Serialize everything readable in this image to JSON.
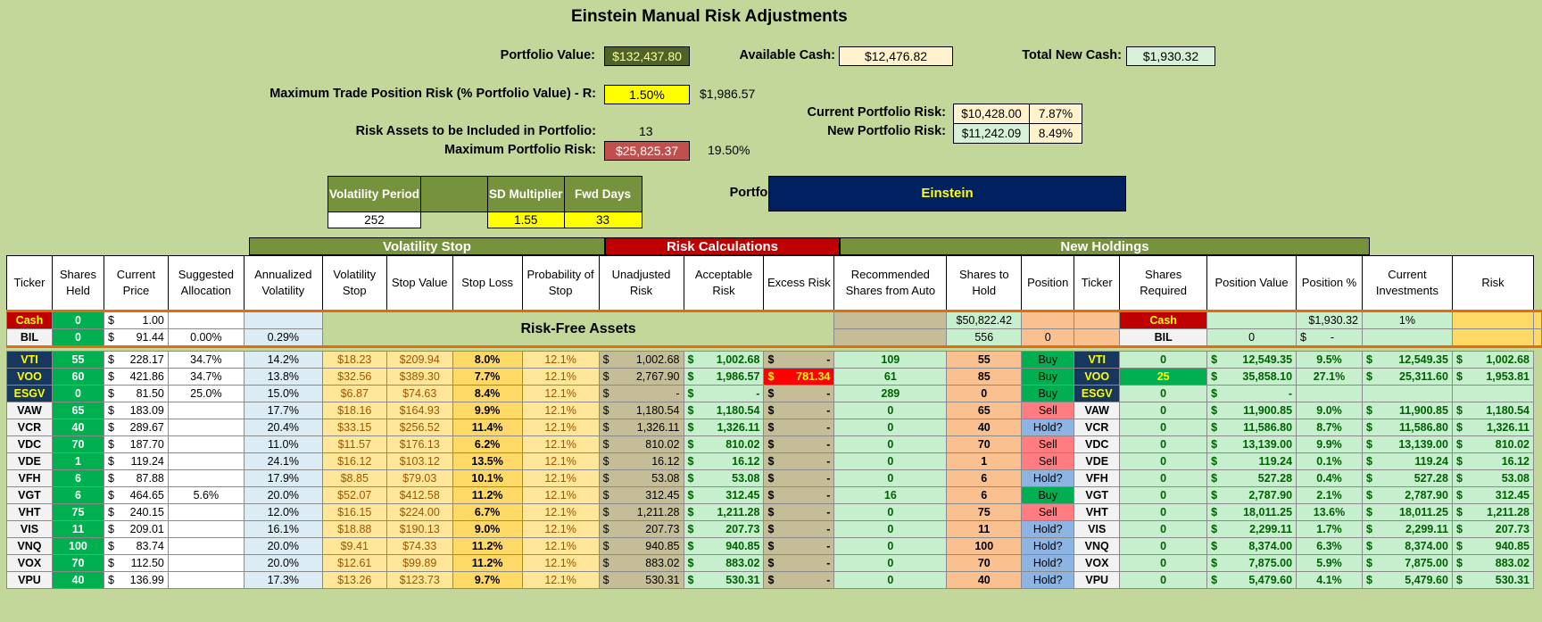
{
  "title": "Einstein Manual Risk Adjustments",
  "summary": {
    "portfolio_value_label": "Portfolio Value:",
    "portfolio_value": "$132,437.80",
    "available_cash_label": "Available Cash:",
    "available_cash": "$12,476.82",
    "total_new_cash_label": "Total New Cash:",
    "total_new_cash": "$1,930.32",
    "max_trade_risk_label": "Maximum Trade Position Risk (% Portfolio Value) - R:",
    "max_trade_risk_pct": "1.50%",
    "max_trade_risk_amt": "$1,986.57",
    "current_risk_label": "Current Portfolio Risk:",
    "current_risk": "$10,428.00",
    "current_risk_pct": "7.87%",
    "new_risk_label": "New Portfolio Risk:",
    "new_risk": "$11,242.09",
    "new_risk_pct": "8.49%",
    "risk_assets_label": "Risk Assets to be Included in Portfolio:",
    "risk_assets": "13",
    "max_portfolio_risk_label": "Maximum Portfolio Risk:",
    "max_portfolio_risk": "$25,825.37",
    "max_portfolio_risk_pct": "19.50%",
    "portfolio_label": "Portfolio:",
    "portfolio_name": "Einstein"
  },
  "params": {
    "vol_period_label": "Volatility Period",
    "sd_label": "SD Multiplier",
    "fwd_label": "Fwd Days",
    "vol_period": "252",
    "sd": "1.55",
    "fwd": "33"
  },
  "bands": {
    "vol_stop": "Volatility Stop",
    "risk_calc": "Risk Calculations",
    "new_holdings": "New Holdings",
    "risk_free": "Risk-Free Assets"
  },
  "headers": [
    "Ticker",
    "Shares Held",
    "Current Price",
    "Suggested Allocation",
    "Annualized Volatility",
    "Volatility Stop",
    "Stop Value",
    "Stop Loss",
    "Probability of Stop",
    "Unadjusted Risk",
    "Acceptable Risk",
    "Excess Risk",
    "Recommended Shares from Auto",
    "Shares to Hold",
    "Position",
    "Ticker",
    "Shares Required",
    "Position Value",
    "Position %",
    "Current Investments",
    "Risk"
  ],
  "cash_row": {
    "ticker": "Cash",
    "shares": "0",
    "price": "1.00",
    "rec": "$50,822.42",
    "ticker2": "Cash",
    "posval": "$1,930.32",
    "pospct": "1%"
  },
  "bil_row": {
    "ticker": "BIL",
    "shares": "0",
    "price": "91.44",
    "alloc": "0.00%",
    "vol": "0.29%",
    "rec": "556",
    "hold": "0",
    "ticker2": "BIL",
    "req": "0",
    "posval": "-"
  },
  "rows": [
    {
      "t": "VTI",
      "sh": "55",
      "pr": "228.17",
      "al": "34.7%",
      "vol": "14.2%",
      "vs": "$18.23",
      "sv": "$209.94",
      "sl": "8.0%",
      "pb": "12.1%",
      "ur": "1,002.68",
      "ar": "1,002.68",
      "er": "-",
      "rec": "109",
      "hold": "55",
      "pos": "Buy",
      "req": "0",
      "pv": "12,549.35",
      "pp": "9.5%",
      "ci": "12,549.35",
      "rk": "1,002.68"
    },
    {
      "t": "VOO",
      "sh": "60",
      "pr": "421.86",
      "al": "34.7%",
      "vol": "13.8%",
      "vs": "$32.56",
      "sv": "$389.30",
      "sl": "7.7%",
      "pb": "12.1%",
      "ur": "2,767.90",
      "ar": "1,986.57",
      "er": "781.34",
      "rec": "61",
      "hold": "85",
      "pos": "Buy",
      "req": "25",
      "pv": "35,858.10",
      "pp": "27.1%",
      "ci": "25,311.60",
      "rk": "1,953.81"
    },
    {
      "t": "ESGV",
      "sh": "0",
      "pr": "81.50",
      "al": "25.0%",
      "vol": "15.0%",
      "vs": "$6.87",
      "sv": "$74.63",
      "sl": "8.4%",
      "pb": "12.1%",
      "ur": "-",
      "ar": "-",
      "er": "-",
      "rec": "289",
      "hold": "0",
      "pos": "Buy",
      "req": "0",
      "pv": "-",
      "pp": "",
      "ci": "",
      "rk": ""
    },
    {
      "t": "VAW",
      "sh": "65",
      "pr": "183.09",
      "al": "",
      "vol": "17.7%",
      "vs": "$18.16",
      "sv": "$164.93",
      "sl": "9.9%",
      "pb": "12.1%",
      "ur": "1,180.54",
      "ar": "1,180.54",
      "er": "-",
      "rec": "0",
      "hold": "65",
      "pos": "Sell",
      "req": "0",
      "pv": "11,900.85",
      "pp": "9.0%",
      "ci": "11,900.85",
      "rk": "1,180.54"
    },
    {
      "t": "VCR",
      "sh": "40",
      "pr": "289.67",
      "al": "",
      "vol": "20.4%",
      "vs": "$33.15",
      "sv": "$256.52",
      "sl": "11.4%",
      "pb": "12.1%",
      "ur": "1,326.11",
      "ar": "1,326.11",
      "er": "-",
      "rec": "0",
      "hold": "40",
      "pos": "Hold?",
      "req": "0",
      "pv": "11,586.80",
      "pp": "8.7%",
      "ci": "11,586.80",
      "rk": "1,326.11"
    },
    {
      "t": "VDC",
      "sh": "70",
      "pr": "187.70",
      "al": "",
      "vol": "11.0%",
      "vs": "$11.57",
      "sv": "$176.13",
      "sl": "6.2%",
      "pb": "12.1%",
      "ur": "810.02",
      "ar": "810.02",
      "er": "-",
      "rec": "0",
      "hold": "70",
      "pos": "Sell",
      "req": "0",
      "pv": "13,139.00",
      "pp": "9.9%",
      "ci": "13,139.00",
      "rk": "810.02"
    },
    {
      "t": "VDE",
      "sh": "1",
      "pr": "119.24",
      "al": "",
      "vol": "24.1%",
      "vs": "$16.12",
      "sv": "$103.12",
      "sl": "13.5%",
      "pb": "12.1%",
      "ur": "16.12",
      "ar": "16.12",
      "er": "-",
      "rec": "0",
      "hold": "1",
      "pos": "Sell",
      "req": "0",
      "pv": "119.24",
      "pp": "0.1%",
      "ci": "119.24",
      "rk": "16.12"
    },
    {
      "t": "VFH",
      "sh": "6",
      "pr": "87.88",
      "al": "",
      "vol": "17.9%",
      "vs": "$8.85",
      "sv": "$79.03",
      "sl": "10.1%",
      "pb": "12.1%",
      "ur": "53.08",
      "ar": "53.08",
      "er": "-",
      "rec": "0",
      "hold": "6",
      "pos": "Hold?",
      "req": "0",
      "pv": "527.28",
      "pp": "0.4%",
      "ci": "527.28",
      "rk": "53.08"
    },
    {
      "t": "VGT",
      "sh": "6",
      "pr": "464.65",
      "al": "5.6%",
      "vol": "20.0%",
      "vs": "$52.07",
      "sv": "$412.58",
      "sl": "11.2%",
      "pb": "12.1%",
      "ur": "312.45",
      "ar": "312.45",
      "er": "-",
      "rec": "16",
      "hold": "6",
      "pos": "Buy",
      "req": "0",
      "pv": "2,787.90",
      "pp": "2.1%",
      "ci": "2,787.90",
      "rk": "312.45"
    },
    {
      "t": "VHT",
      "sh": "75",
      "pr": "240.15",
      "al": "",
      "vol": "12.0%",
      "vs": "$16.15",
      "sv": "$224.00",
      "sl": "6.7%",
      "pb": "12.1%",
      "ur": "1,211.28",
      "ar": "1,211.28",
      "er": "-",
      "rec": "0",
      "hold": "75",
      "pos": "Sell",
      "req": "0",
      "pv": "18,011.25",
      "pp": "13.6%",
      "ci": "18,011.25",
      "rk": "1,211.28"
    },
    {
      "t": "VIS",
      "sh": "11",
      "pr": "209.01",
      "al": "",
      "vol": "16.1%",
      "vs": "$18.88",
      "sv": "$190.13",
      "sl": "9.0%",
      "pb": "12.1%",
      "ur": "207.73",
      "ar": "207.73",
      "er": "-",
      "rec": "0",
      "hold": "11",
      "pos": "Hold?",
      "req": "0",
      "pv": "2,299.11",
      "pp": "1.7%",
      "ci": "2,299.11",
      "rk": "207.73"
    },
    {
      "t": "VNQ",
      "sh": "100",
      "pr": "83.74",
      "al": "",
      "vol": "20.0%",
      "vs": "$9.41",
      "sv": "$74.33",
      "sl": "11.2%",
      "pb": "12.1%",
      "ur": "940.85",
      "ar": "940.85",
      "er": "-",
      "rec": "0",
      "hold": "100",
      "pos": "Hold?",
      "req": "0",
      "pv": "8,374.00",
      "pp": "6.3%",
      "ci": "8,374.00",
      "rk": "940.85"
    },
    {
      "t": "VOX",
      "sh": "70",
      "pr": "112.50",
      "al": "",
      "vol": "20.0%",
      "vs": "$12.61",
      "sv": "$99.89",
      "sl": "11.2%",
      "pb": "12.1%",
      "ur": "883.02",
      "ar": "883.02",
      "er": "-",
      "rec": "0",
      "hold": "70",
      "pos": "Hold?",
      "req": "0",
      "pv": "7,875.00",
      "pp": "5.9%",
      "ci": "7,875.00",
      "rk": "883.02"
    },
    {
      "t": "VPU",
      "sh": "40",
      "pr": "136.99",
      "al": "",
      "vol": "17.3%",
      "vs": "$13.26",
      "sv": "$123.73",
      "sl": "9.7%",
      "pb": "12.1%",
      "ur": "530.31",
      "ar": "530.31",
      "er": "-",
      "rec": "0",
      "hold": "40",
      "pos": "Hold?",
      "req": "0",
      "pv": "5,479.60",
      "pp": "4.1%",
      "ci": "5,479.60",
      "rk": "530.31"
    }
  ],
  "currency_symbol": "$"
}
